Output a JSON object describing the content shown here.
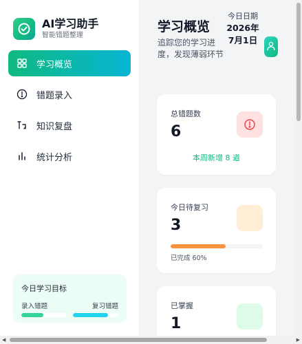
{
  "brand": {
    "title": "AI学习助手",
    "subtitle": "智能错题整理"
  },
  "nav": [
    {
      "label": "学习概览",
      "icon": "grid-icon",
      "active": true
    },
    {
      "label": "错题录入",
      "icon": "alert-circle-icon",
      "active": false
    },
    {
      "label": "知识复盘",
      "icon": "refresh-icon",
      "active": false
    },
    {
      "label": "统计分析",
      "icon": "bar-chart-icon",
      "active": false
    }
  ],
  "goal": {
    "title": "今日学习目标",
    "left_label": "录入错题",
    "right_label": "复习错题",
    "left_progress": 0.48,
    "right_progress": 0.78
  },
  "header": {
    "title": "学习概览",
    "description": "追踪您的学习进度，发现薄弱环节",
    "date_label": "今日日期",
    "date_year": "2026年",
    "date_day": "7月1日"
  },
  "cards": [
    {
      "label": "总错题数",
      "value": "6",
      "note": "本周新增 8 道",
      "icon": "alert-circle-icon"
    },
    {
      "label": "今日待复习",
      "value": "3",
      "progress_note": "已完成 60%",
      "progress": 0.6
    },
    {
      "label": "已掌握",
      "value": "1"
    }
  ],
  "colors": {
    "accent_start": "#10b981",
    "accent_end": "#06b6d4",
    "danger": "#ef4444",
    "warning": "#fb923c"
  }
}
